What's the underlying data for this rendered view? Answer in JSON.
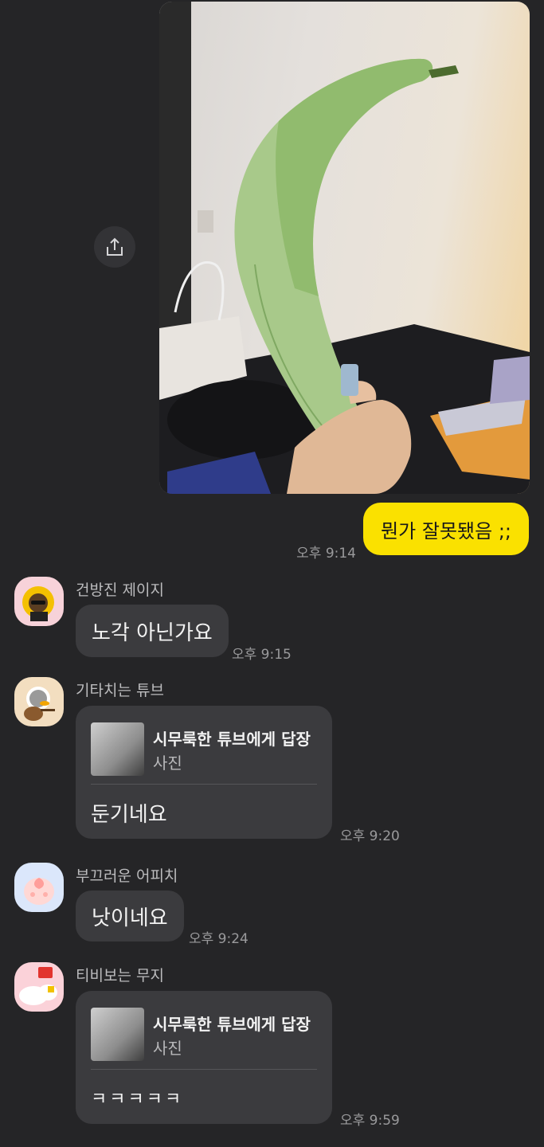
{
  "messages": {
    "mine": {
      "text": "뭔가 잘못됐음 ;;",
      "time": "오후 9:14"
    },
    "m1": {
      "sender": "건방진 제이지",
      "text": "노각 아닌가요",
      "time": "오후 9:15"
    },
    "m2": {
      "sender": "기타치는 튜브",
      "reply_title": "시무룩한 튜브에게 답장",
      "reply_sub": "사진",
      "text": "둔기네요",
      "time": "오후 9:20"
    },
    "m3": {
      "sender": "부끄러운 어피치",
      "text": "낫이네요",
      "time": "오후 9:24"
    },
    "m4": {
      "sender": "티비보는 무지",
      "reply_title": "시무룩한 튜브에게 답장",
      "reply_sub": "사진",
      "text": "ㅋㅋㅋㅋㅋ",
      "time": "오후 9:59"
    }
  },
  "icons": {
    "share": "share-icon"
  },
  "colors": {
    "background": "#252527",
    "my_bubble": "#fae100",
    "other_bubble": "#3b3b3e"
  }
}
